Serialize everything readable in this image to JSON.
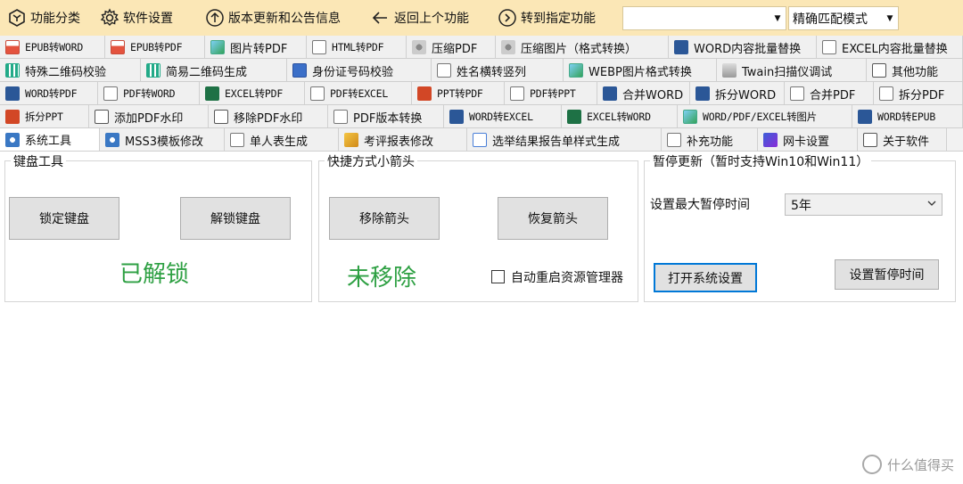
{
  "toolbar": {
    "buttons": [
      {
        "label": "功能分类",
        "icon": "category-icon"
      },
      {
        "label": "软件设置",
        "icon": "gear-icon"
      },
      {
        "label": "版本更新和公告信息",
        "icon": "arrow-up-circle-icon"
      },
      {
        "label": "返回上个功能",
        "icon": "back-arrow-icon"
      },
      {
        "label": "转到指定功能",
        "icon": "arrow-right-circle-icon"
      }
    ],
    "search_value": "",
    "match_mode": "精确匹配模式"
  },
  "tabs": {
    "row1": [
      "EPUB转WORD",
      "EPUB转PDF",
      "图片转PDF",
      "HTML转PDF",
      "压缩PDF",
      "压缩图片（格式转换）",
      "WORD内容批量替换",
      "EXCEL内容批量替换"
    ],
    "row2": [
      "特殊二维码校验",
      "简易二维码生成",
      "身份证号码校验",
      "姓名横转竖列",
      "WEBP图片格式转换",
      "Twain扫描仪调试",
      "其他功能"
    ],
    "row3": [
      "WORD转PDF",
      "PDF转WORD",
      "EXCEL转PDF",
      "PDF转EXCEL",
      "PPT转PDF",
      "PDF转PPT",
      "合并WORD",
      "拆分WORD",
      "合并PDF",
      "拆分PDF"
    ],
    "row4": [
      "拆分PPT",
      "添加PDF水印",
      "移除PDF水印",
      "PDF版本转换",
      "WORD转EXCEL",
      "EXCEL转WORD",
      "WORD/PDF/EXCEL转图片",
      "WORD转EPUB"
    ],
    "row5": [
      "系统工具",
      "MSS3模板修改",
      "单人表生成",
      "考评报表修改",
      "选举结果报告单样式生成",
      "补充功能",
      "网卡设置",
      "关于软件"
    ]
  },
  "keyboard": {
    "title": "键盘工具",
    "lock_label": "锁定键盘",
    "unlock_label": "解锁键盘",
    "status": "已解锁"
  },
  "shortcut": {
    "title": "快捷方式小箭头",
    "remove_label": "移除箭头",
    "restore_label": "恢复箭头",
    "status": "未移除",
    "restart_explorer_label": "自动重启资源管理器"
  },
  "pause_update": {
    "title": "暂停更新（暂时支持Win10和Win11）",
    "max_pause_label": "设置最大暂停时间",
    "max_pause_value": "5年",
    "open_settings_label": "打开系统设置",
    "set_pause_label": "设置暂停时间"
  },
  "watermark": "什么值得买",
  "colors": {
    "toolbar_bg": "#fbe7b6",
    "status_green": "#2ea043",
    "focus_blue": "#0078d7"
  }
}
